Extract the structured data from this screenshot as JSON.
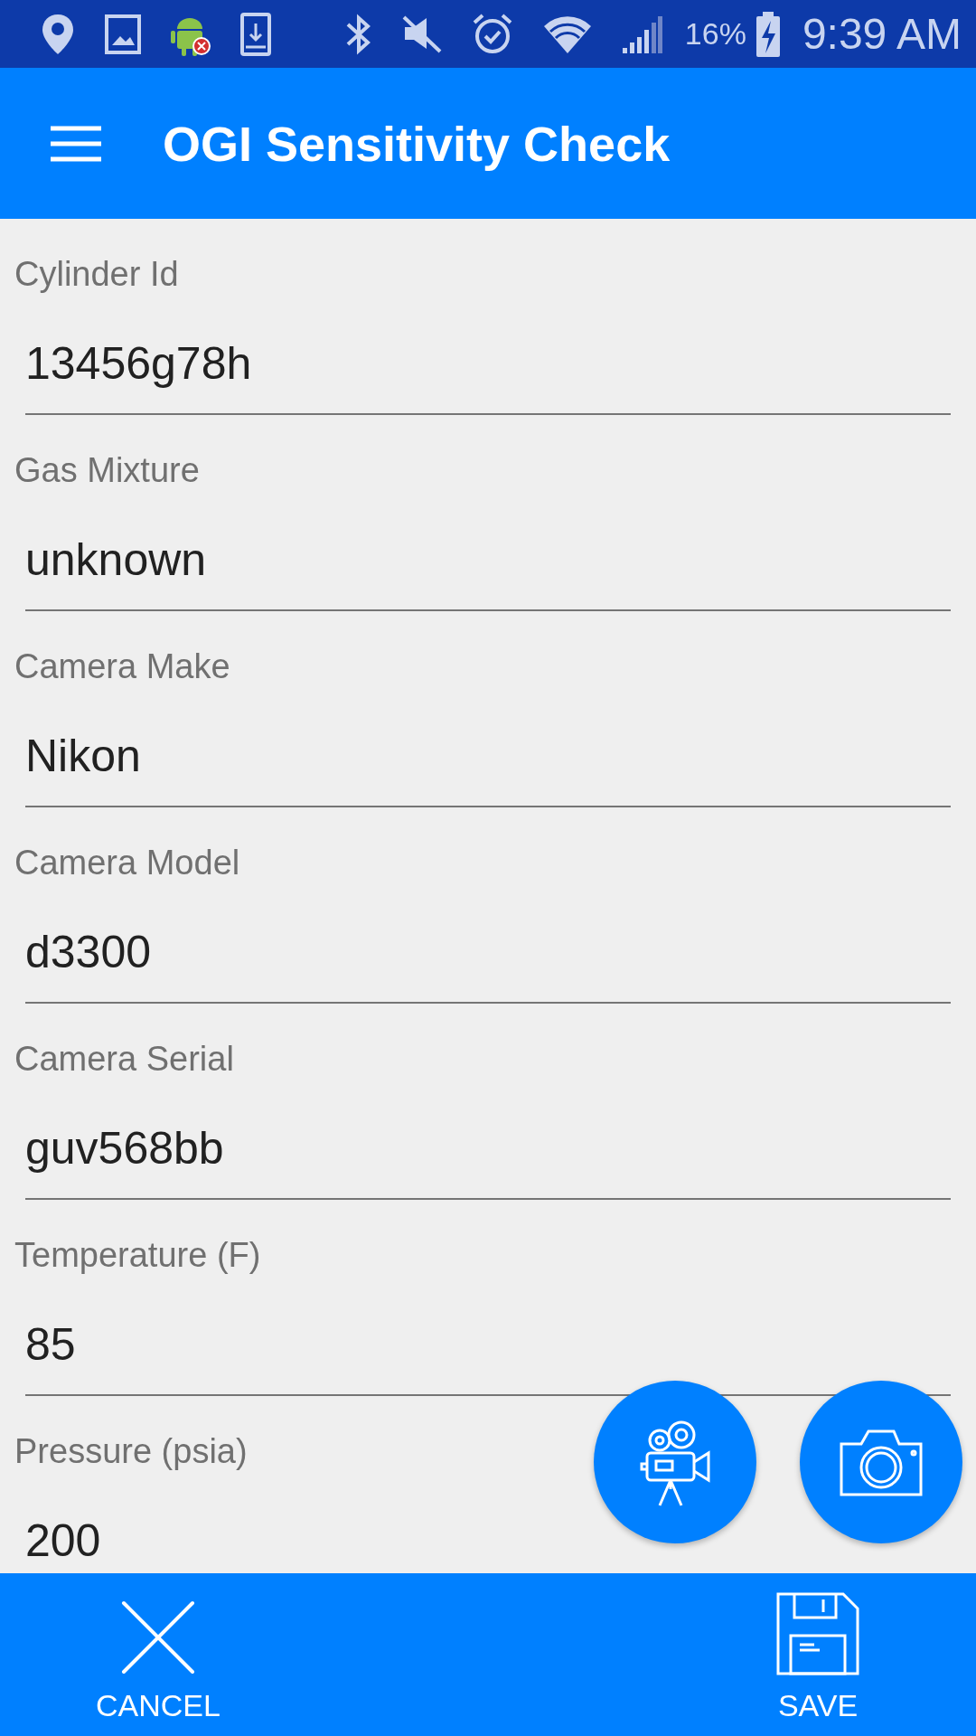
{
  "status_bar": {
    "battery": "16%",
    "time": "9:39 AM"
  },
  "app_bar": {
    "title": "OGI Sensitivity Check"
  },
  "fields": [
    {
      "label": "Cylinder Id",
      "value": "13456g78h"
    },
    {
      "label": "Gas Mixture",
      "value": "unknown"
    },
    {
      "label": "Camera Make",
      "value": "Nikon"
    },
    {
      "label": "Camera Model",
      "value": "d3300"
    },
    {
      "label": "Camera Serial",
      "value": "guv568bb"
    },
    {
      "label": "Temperature (F)",
      "value": "85"
    },
    {
      "label": "Pressure (psia)",
      "value": "200"
    }
  ],
  "bottom_bar": [
    {
      "kind": "cancel",
      "label": "CANCEL"
    },
    {
      "kind": "save",
      "label": "SAVE"
    }
  ]
}
